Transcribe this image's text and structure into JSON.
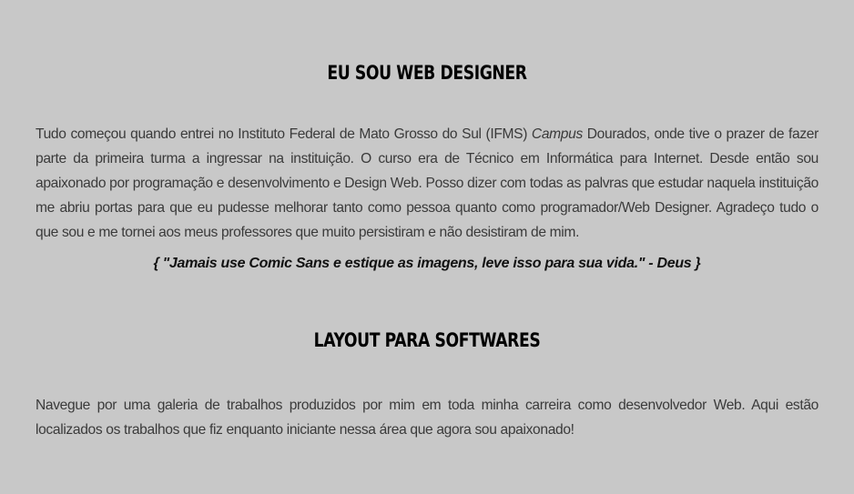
{
  "section_1": {
    "title": "EU SOU WEB DESIGNER",
    "paragraph_before": "Tudo começou quando entrei no Instituto Federal de Mato Grosso do Sul (IFMS) ",
    "paragraph_emphasis": "Campus",
    "paragraph_after": " Dourados, onde tive o prazer de fazer parte da primeira turma a ingressar na instituição. O curso era de Técnico em Informática para Internet. Desde então sou apaixonado por programação e desenvolvimento e Design Web. Posso dizer com todas as palvras que estudar naquela instituição me abriu portas para que eu pudesse melhorar tanto como pessoa quanto como programador/Web Designer. Agradeço tudo o que sou e me tornei aos meus professores que muito persistiram e não desistiram de mim.",
    "quote": "{ \"Jamais use Comic Sans e estique as imagens, leve isso para sua vida.\" - Deus }"
  },
  "section_2": {
    "title": "LAYOUT PARA SOFTWARES",
    "paragraph": "Navegue por uma galeria de trabalhos produzidos por mim em toda minha carreira como desenvolvedor Web. Aqui estão localizados os trabalhos que fiz enquanto iniciante nessa área que agora sou apaixonado!"
  }
}
